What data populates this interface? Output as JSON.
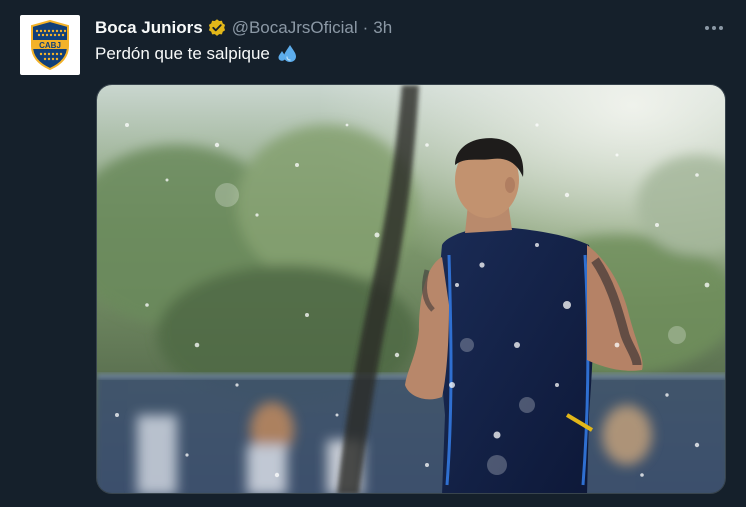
{
  "tweet": {
    "display_name": "Boca Juniors",
    "handle": "@BocaJrsOficial",
    "separator": "·",
    "time": "3h",
    "text": "Perdón que te salpique",
    "text_emoji": "sweat-droplets-emoji",
    "avatar_text": "CABJ",
    "verified_icon": "verified-badge-icon",
    "more_icon": "more-options-icon",
    "colors": {
      "background": "#15202b",
      "text": "#f7f9f9",
      "secondary": "#8b98a5",
      "verified_gold": "#e2b719",
      "boca_blue": "#103f79",
      "boca_gold": "#f3b229"
    }
  }
}
